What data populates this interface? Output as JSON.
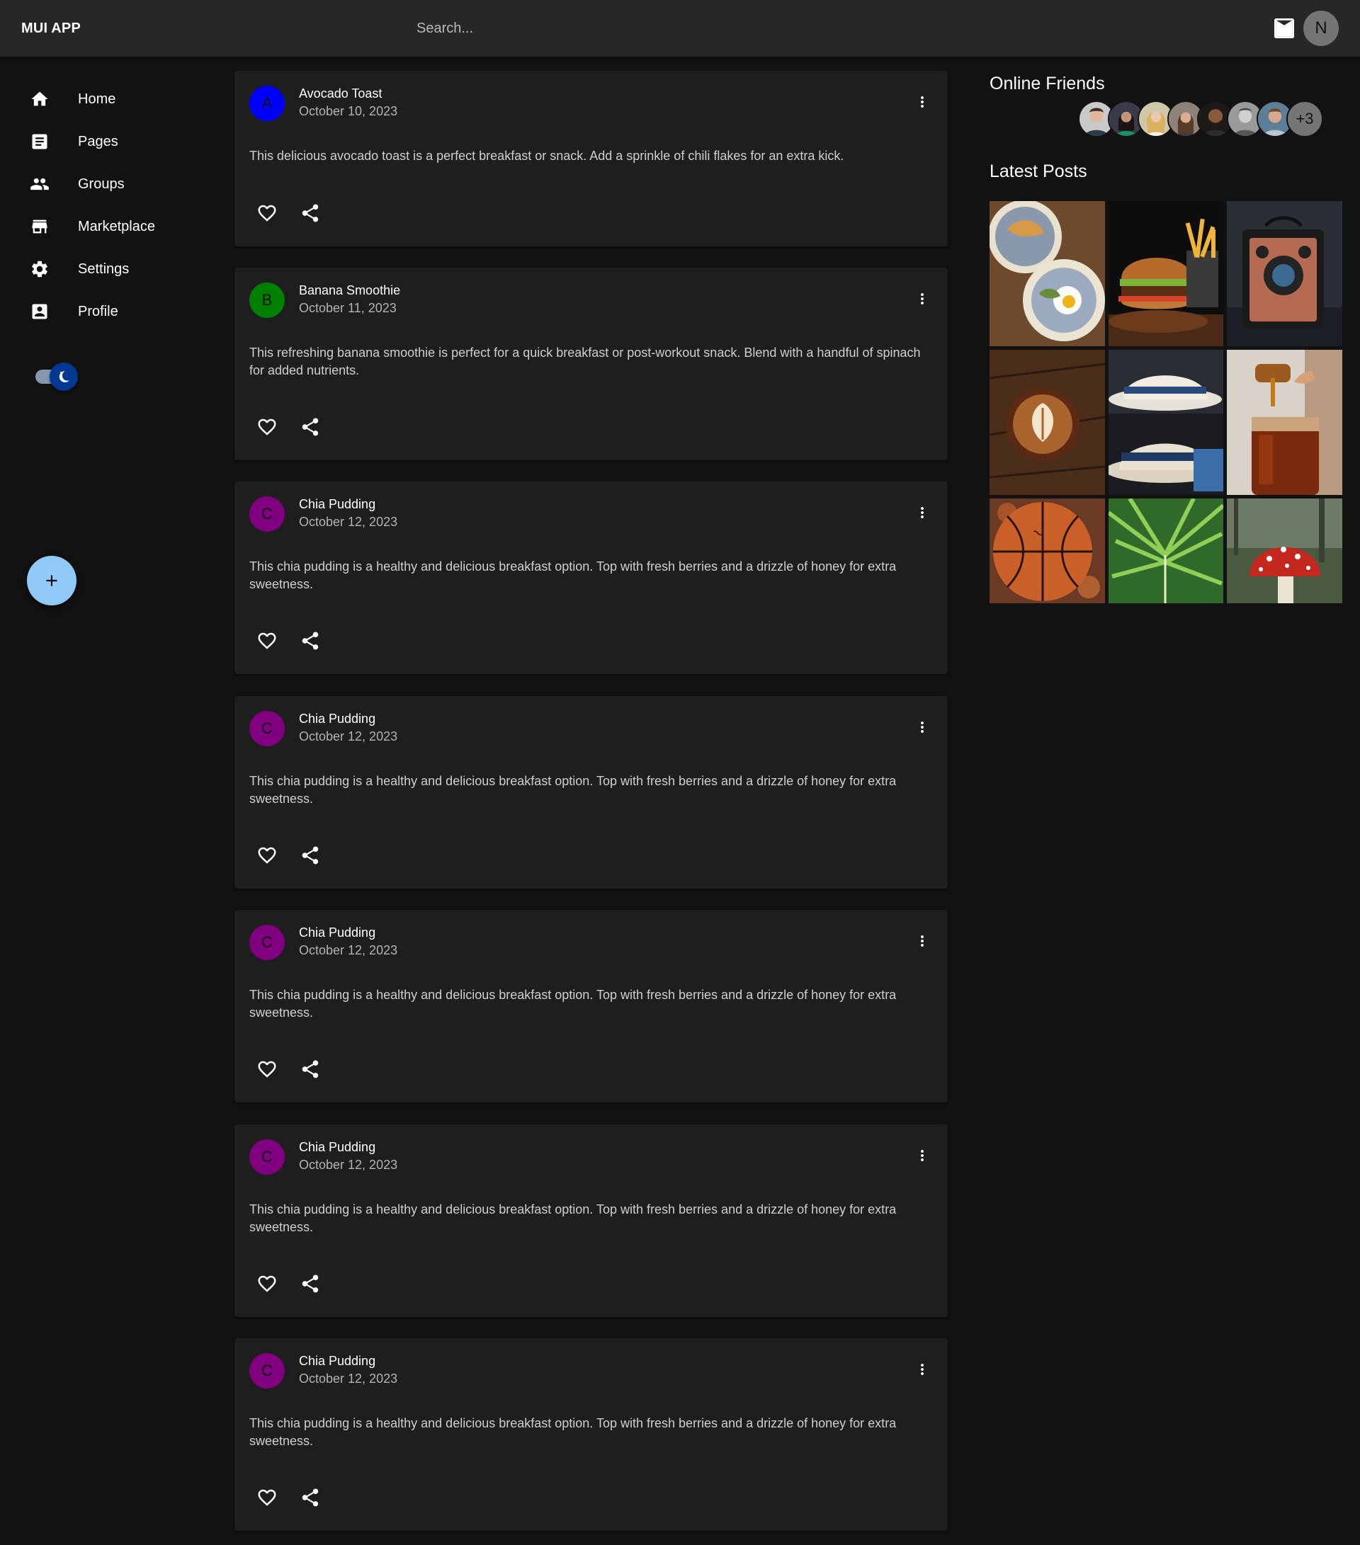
{
  "app": {
    "title": "MUI APP"
  },
  "search": {
    "placeholder": "Search..."
  },
  "header": {
    "avatar_letter": "N",
    "icons": [
      "mail-icon"
    ]
  },
  "sidebar": {
    "items": [
      {
        "label": "Home",
        "icon": "home-icon"
      },
      {
        "label": "Pages",
        "icon": "article-icon"
      },
      {
        "label": "Groups",
        "icon": "people-icon"
      },
      {
        "label": "Marketplace",
        "icon": "storefront-icon"
      },
      {
        "label": "Settings",
        "icon": "gear-icon"
      },
      {
        "label": "Profile",
        "icon": "account-box-icon"
      }
    ],
    "theme_toggle": {
      "mode": "dark",
      "icon": "moon-icon"
    },
    "fab": {
      "icon": "plus-icon"
    }
  },
  "colors": {
    "background": "#121212",
    "card": "#1e1e1e",
    "appbar": "#272727",
    "accent": "#90caf9",
    "avatar_a": "#0000ff",
    "avatar_b": "#008000",
    "avatar_c": "#800080"
  },
  "posts": [
    {
      "letter": "A",
      "avatar_color": "#0000ff",
      "title": "Avocado Toast",
      "date": "October 10, 2023",
      "body": "This delicious avocado toast is a perfect breakfast or snack. Add a sprinkle of chili flakes for an extra kick."
    },
    {
      "letter": "B",
      "avatar_color": "#008000",
      "title": "Banana Smoothie",
      "date": "October 11, 2023",
      "body": "This refreshing banana smoothie is perfect for a quick breakfast or post-workout snack. Blend with a handful of spinach for added nutrients."
    },
    {
      "letter": "C",
      "avatar_color": "#800080",
      "title": "Chia Pudding",
      "date": "October 12, 2023",
      "body": "This chia pudding is a healthy and delicious breakfast option. Top with fresh berries and a drizzle of honey for extra sweetness."
    },
    {
      "letter": "C",
      "avatar_color": "#800080",
      "title": "Chia Pudding",
      "date": "October 12, 2023",
      "body": "This chia pudding is a healthy and delicious breakfast option. Top with fresh berries and a drizzle of honey for extra sweetness."
    },
    {
      "letter": "C",
      "avatar_color": "#800080",
      "title": "Chia Pudding",
      "date": "October 12, 2023",
      "body": "This chia pudding is a healthy and delicious breakfast option. Top with fresh berries and a drizzle of honey for extra sweetness."
    },
    {
      "letter": "C",
      "avatar_color": "#800080",
      "title": "Chia Pudding",
      "date": "October 12, 2023",
      "body": "This chia pudding is a healthy and delicious breakfast option. Top with fresh berries and a drizzle of honey for extra sweetness."
    },
    {
      "letter": "C",
      "avatar_color": "#800080",
      "title": "Chia Pudding",
      "date": "October 12, 2023",
      "body": "This chia pudding is a healthy and delicious breakfast option. Top with fresh berries and a drizzle of honey for extra sweetness."
    }
  ],
  "right_panel": {
    "online_friends": {
      "heading": "Online Friends",
      "extra_count": "+3"
    },
    "latest_posts": {
      "heading": "Latest Posts",
      "photos": [
        "breakfast-plates",
        "burger-fries",
        "vintage-camera",
        "latte-art",
        "hats",
        "honey-jar",
        "basketball",
        "fern",
        "mushroom"
      ]
    }
  }
}
